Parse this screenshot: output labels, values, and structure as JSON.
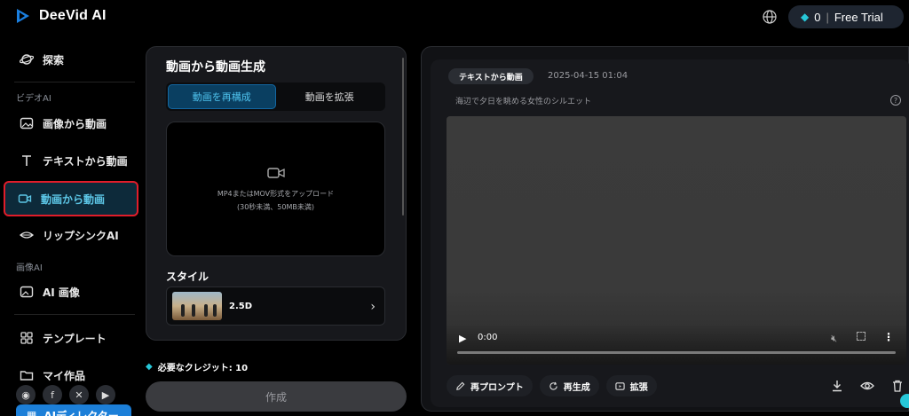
{
  "app": {
    "logo_text": "DeeVid AI",
    "credits_count": "0",
    "free_trial_label": "Free Trial",
    "accent_color": "#27c7d8"
  },
  "sidebar": {
    "explore": "探索",
    "section_video": "ビデオAI",
    "image_to_video": "画像から動画",
    "text_to_video": "テキストから動画",
    "video_to_video": "動画から動画",
    "lipsync": "リップシンクAI",
    "section_image": "画像AI",
    "ai_image": "AI 画像",
    "templates": "テンプレート",
    "my_works": "マイ作品",
    "ai_director": "AIディレクター",
    "social": [
      "discord-icon",
      "facebook-icon",
      "x-icon",
      "youtube-icon"
    ]
  },
  "panel": {
    "title": "動画から動画生成",
    "tab_restyle": "動画を再構成",
    "tab_extend": "動画を拡張",
    "upload_line1": "MP4またはMOV形式をアップロード",
    "upload_line2": "(30秒未満、50MB未満)",
    "style_label": "スタイル",
    "style_name": "2.5D",
    "credits_label": "必要なクレジット: 10",
    "create_button": "作成"
  },
  "result": {
    "tag": "テキストから動画",
    "date": "2025-04-15 01:04",
    "prompt": "海辺で夕日を眺める女性のシルエット",
    "time": "0:00",
    "reprompt": "再プロンプト",
    "regenerate": "再生成",
    "extend": "拡張"
  }
}
